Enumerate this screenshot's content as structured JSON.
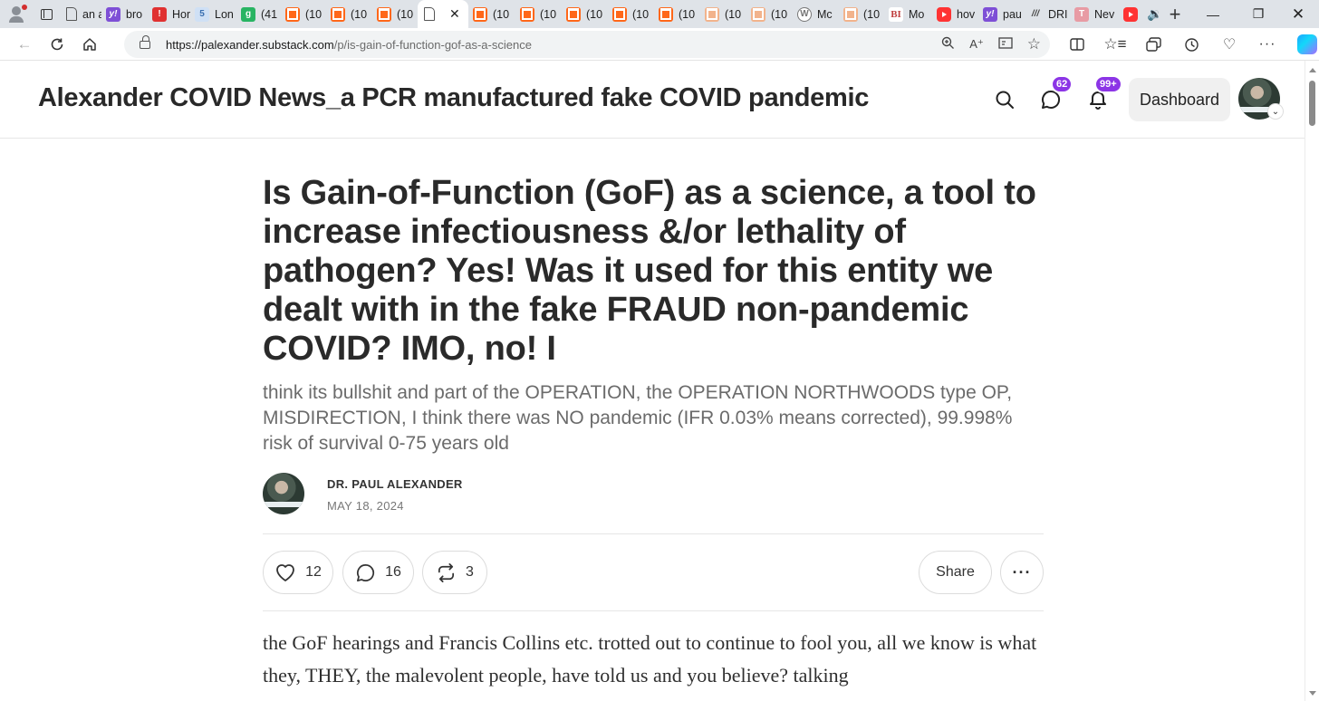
{
  "browser": {
    "tabs": [
      {
        "title": "an a",
        "favicon": "doc-icon"
      },
      {
        "title": "bro",
        "favicon": "yahoo-icon"
      },
      {
        "title": "Hor",
        "favicon": "red-icon"
      },
      {
        "title": "Lon",
        "favicon": "five-icon"
      },
      {
        "title": "(41",
        "favicon": "green-icon"
      },
      {
        "title": "(10",
        "favicon": "substack-icon"
      },
      {
        "title": "(10",
        "favicon": "substack-icon"
      },
      {
        "title": "(10",
        "favicon": "substack-icon"
      },
      {
        "title": "",
        "favicon": "doc-icon",
        "active": true
      },
      {
        "title": "(10",
        "favicon": "substack-icon"
      },
      {
        "title": "(10",
        "favicon": "substack-icon"
      },
      {
        "title": "(10",
        "favicon": "substack-icon"
      },
      {
        "title": "(10",
        "favicon": "substack-icon"
      },
      {
        "title": "(10",
        "favicon": "substack-icon"
      },
      {
        "title": "(10",
        "favicon": "substack-faded-icon"
      },
      {
        "title": "(10",
        "favicon": "substack-faded-icon"
      },
      {
        "title": "Mc",
        "favicon": "wordpress-icon"
      },
      {
        "title": "(10",
        "favicon": "substack-faded-icon"
      },
      {
        "title": "Mo",
        "favicon": "bi-icon"
      },
      {
        "title": "hov",
        "favicon": "youtube-icon"
      },
      {
        "title": "pau",
        "favicon": "yahoo-icon"
      },
      {
        "title": "DRI",
        "favicon": "ink-icon"
      },
      {
        "title": "Nev",
        "favicon": "pink-icon"
      }
    ],
    "favicon_text": {
      "yahoo": "y!",
      "five": "5",
      "green": "g",
      "wp": "W",
      "bi": "BI",
      "ink": "///",
      "red": "!",
      "pink": "T"
    },
    "url_host": "https://palexander.substack.com",
    "url_path": "/p/is-gain-of-function-gof-as-a-science"
  },
  "site": {
    "title": "Alexander COVID News_a PCR manufactured fake COVID pandemic",
    "chat_badge": "62",
    "notif_badge": "99+",
    "dashboard_label": "Dashboard",
    "badge_color": "#8c35e6"
  },
  "post": {
    "title": "Is Gain-of-Function (GoF) as a science, a tool to increase infectiousness &/or lethality of pathogen? Yes! Was it used for this entity we dealt with in the fake FRAUD non-pandemic COVID? IMO, no! I",
    "subtitle": "think its bullshit and part of the OPERATION, the OPERATION NORTHWOODS type OP, MISDIRECTION, I think there was NO pandemic (IFR 0.03% means corrected), 99.998% risk of survival 0-75 years old",
    "author": "DR. PAUL ALEXANDER",
    "date": "MAY 18, 2024",
    "likes": "12",
    "comments": "16",
    "restacks": "3",
    "share_label": "Share",
    "body": "the GoF hearings and Francis Collins etc. trotted out to continue to fool you, all we know is what they, THEY, the malevolent people, have told us and you believe? talking"
  }
}
